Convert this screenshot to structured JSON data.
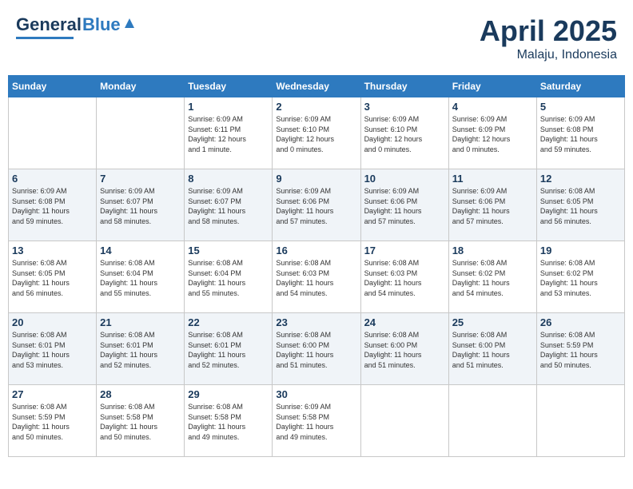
{
  "header": {
    "logo_general": "General",
    "logo_blue": "Blue",
    "month": "April 2025",
    "location": "Malaju, Indonesia"
  },
  "columns": [
    "Sunday",
    "Monday",
    "Tuesday",
    "Wednesday",
    "Thursday",
    "Friday",
    "Saturday"
  ],
  "weeks": [
    [
      {
        "day": "",
        "lines": []
      },
      {
        "day": "",
        "lines": []
      },
      {
        "day": "1",
        "lines": [
          "Sunrise: 6:09 AM",
          "Sunset: 6:11 PM",
          "Daylight: 12 hours",
          "and 1 minute."
        ]
      },
      {
        "day": "2",
        "lines": [
          "Sunrise: 6:09 AM",
          "Sunset: 6:10 PM",
          "Daylight: 12 hours",
          "and 0 minutes."
        ]
      },
      {
        "day": "3",
        "lines": [
          "Sunrise: 6:09 AM",
          "Sunset: 6:10 PM",
          "Daylight: 12 hours",
          "and 0 minutes."
        ]
      },
      {
        "day": "4",
        "lines": [
          "Sunrise: 6:09 AM",
          "Sunset: 6:09 PM",
          "Daylight: 12 hours",
          "and 0 minutes."
        ]
      },
      {
        "day": "5",
        "lines": [
          "Sunrise: 6:09 AM",
          "Sunset: 6:08 PM",
          "Daylight: 11 hours",
          "and 59 minutes."
        ]
      }
    ],
    [
      {
        "day": "6",
        "lines": [
          "Sunrise: 6:09 AM",
          "Sunset: 6:08 PM",
          "Daylight: 11 hours",
          "and 59 minutes."
        ]
      },
      {
        "day": "7",
        "lines": [
          "Sunrise: 6:09 AM",
          "Sunset: 6:07 PM",
          "Daylight: 11 hours",
          "and 58 minutes."
        ]
      },
      {
        "day": "8",
        "lines": [
          "Sunrise: 6:09 AM",
          "Sunset: 6:07 PM",
          "Daylight: 11 hours",
          "and 58 minutes."
        ]
      },
      {
        "day": "9",
        "lines": [
          "Sunrise: 6:09 AM",
          "Sunset: 6:06 PM",
          "Daylight: 11 hours",
          "and 57 minutes."
        ]
      },
      {
        "day": "10",
        "lines": [
          "Sunrise: 6:09 AM",
          "Sunset: 6:06 PM",
          "Daylight: 11 hours",
          "and 57 minutes."
        ]
      },
      {
        "day": "11",
        "lines": [
          "Sunrise: 6:09 AM",
          "Sunset: 6:06 PM",
          "Daylight: 11 hours",
          "and 57 minutes."
        ]
      },
      {
        "day": "12",
        "lines": [
          "Sunrise: 6:08 AM",
          "Sunset: 6:05 PM",
          "Daylight: 11 hours",
          "and 56 minutes."
        ]
      }
    ],
    [
      {
        "day": "13",
        "lines": [
          "Sunrise: 6:08 AM",
          "Sunset: 6:05 PM",
          "Daylight: 11 hours",
          "and 56 minutes."
        ]
      },
      {
        "day": "14",
        "lines": [
          "Sunrise: 6:08 AM",
          "Sunset: 6:04 PM",
          "Daylight: 11 hours",
          "and 55 minutes."
        ]
      },
      {
        "day": "15",
        "lines": [
          "Sunrise: 6:08 AM",
          "Sunset: 6:04 PM",
          "Daylight: 11 hours",
          "and 55 minutes."
        ]
      },
      {
        "day": "16",
        "lines": [
          "Sunrise: 6:08 AM",
          "Sunset: 6:03 PM",
          "Daylight: 11 hours",
          "and 54 minutes."
        ]
      },
      {
        "day": "17",
        "lines": [
          "Sunrise: 6:08 AM",
          "Sunset: 6:03 PM",
          "Daylight: 11 hours",
          "and 54 minutes."
        ]
      },
      {
        "day": "18",
        "lines": [
          "Sunrise: 6:08 AM",
          "Sunset: 6:02 PM",
          "Daylight: 11 hours",
          "and 54 minutes."
        ]
      },
      {
        "day": "19",
        "lines": [
          "Sunrise: 6:08 AM",
          "Sunset: 6:02 PM",
          "Daylight: 11 hours",
          "and 53 minutes."
        ]
      }
    ],
    [
      {
        "day": "20",
        "lines": [
          "Sunrise: 6:08 AM",
          "Sunset: 6:01 PM",
          "Daylight: 11 hours",
          "and 53 minutes."
        ]
      },
      {
        "day": "21",
        "lines": [
          "Sunrise: 6:08 AM",
          "Sunset: 6:01 PM",
          "Daylight: 11 hours",
          "and 52 minutes."
        ]
      },
      {
        "day": "22",
        "lines": [
          "Sunrise: 6:08 AM",
          "Sunset: 6:01 PM",
          "Daylight: 11 hours",
          "and 52 minutes."
        ]
      },
      {
        "day": "23",
        "lines": [
          "Sunrise: 6:08 AM",
          "Sunset: 6:00 PM",
          "Daylight: 11 hours",
          "and 51 minutes."
        ]
      },
      {
        "day": "24",
        "lines": [
          "Sunrise: 6:08 AM",
          "Sunset: 6:00 PM",
          "Daylight: 11 hours",
          "and 51 minutes."
        ]
      },
      {
        "day": "25",
        "lines": [
          "Sunrise: 6:08 AM",
          "Sunset: 6:00 PM",
          "Daylight: 11 hours",
          "and 51 minutes."
        ]
      },
      {
        "day": "26",
        "lines": [
          "Sunrise: 6:08 AM",
          "Sunset: 5:59 PM",
          "Daylight: 11 hours",
          "and 50 minutes."
        ]
      }
    ],
    [
      {
        "day": "27",
        "lines": [
          "Sunrise: 6:08 AM",
          "Sunset: 5:59 PM",
          "Daylight: 11 hours",
          "and 50 minutes."
        ]
      },
      {
        "day": "28",
        "lines": [
          "Sunrise: 6:08 AM",
          "Sunset: 5:58 PM",
          "Daylight: 11 hours",
          "and 50 minutes."
        ]
      },
      {
        "day": "29",
        "lines": [
          "Sunrise: 6:08 AM",
          "Sunset: 5:58 PM",
          "Daylight: 11 hours",
          "and 49 minutes."
        ]
      },
      {
        "day": "30",
        "lines": [
          "Sunrise: 6:09 AM",
          "Sunset: 5:58 PM",
          "Daylight: 11 hours",
          "and 49 minutes."
        ]
      },
      {
        "day": "",
        "lines": []
      },
      {
        "day": "",
        "lines": []
      },
      {
        "day": "",
        "lines": []
      }
    ]
  ]
}
